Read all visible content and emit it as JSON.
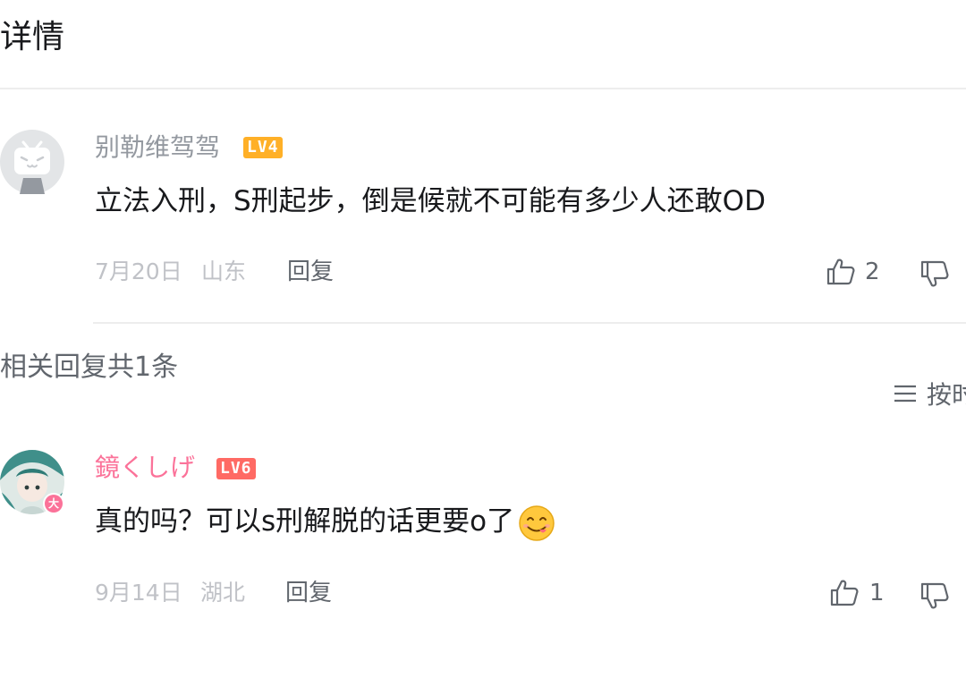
{
  "header": {
    "title": "详情"
  },
  "main_comment": {
    "username": "别勒维驾驾",
    "username_color": "#9499a0",
    "level": "LV4",
    "level_color": "#ffb027",
    "content": "立法入刑，S刑起步，倒是候就不可能有多少人还敢OD",
    "date": "7月20日",
    "location": "山东",
    "reply_label": "回复",
    "like_count": "2",
    "avatar": "bilibili-tv-default-avatar"
  },
  "replies_section": {
    "header": "相关回复共1条",
    "sort_label": "按时"
  },
  "reply": {
    "username": "鏡くしげ",
    "username_color": "#fb7299",
    "level": "LV6",
    "level_color": "#ff6a64",
    "avatar_badge": "大",
    "avatar_badge_color": "#fb7299",
    "content": "真的吗？可以s刑解脱的话更要o了",
    "emoji": "yum-face-emoji",
    "date": "9月14日",
    "location": "湖北",
    "reply_label": "回复",
    "like_count": "1"
  }
}
